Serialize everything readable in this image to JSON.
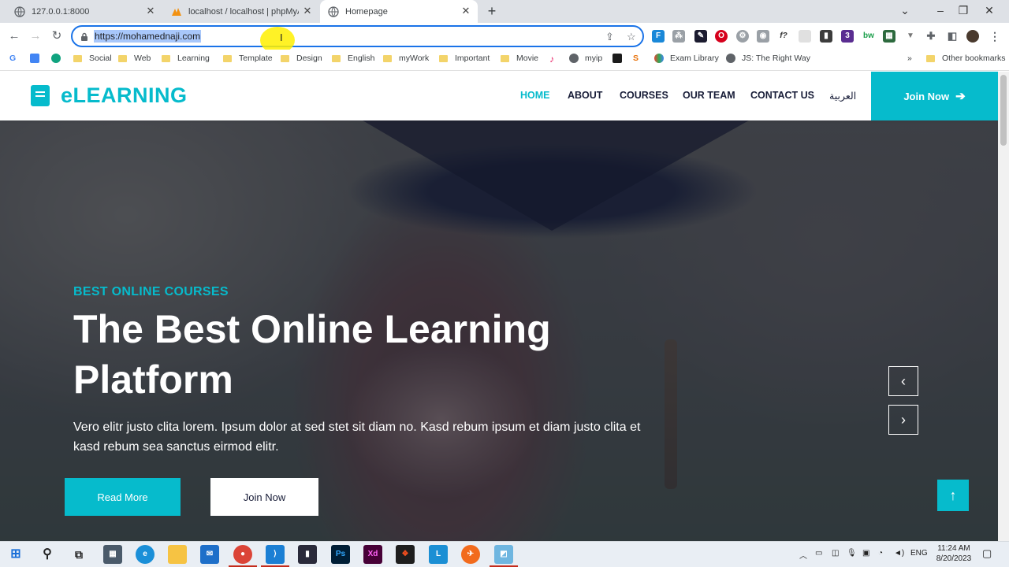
{
  "browser": {
    "tabs": [
      {
        "title": "127.0.0.1:8000",
        "active": false
      },
      {
        "title": "localhost / localhost | phpMyAdmin",
        "active": false
      },
      {
        "title": "Homepage",
        "active": true
      }
    ],
    "new_tab_symbol": "+",
    "window_controls": {
      "minimize": "–",
      "maximize": "❐",
      "close": "✕"
    },
    "chevron": "⌄",
    "url": "https://mohamednaji.com",
    "bookmarks": [
      "Social",
      "Web",
      "Learning",
      "Template",
      "Design",
      "English",
      "myWork",
      "Important",
      "Movie",
      "myip",
      "Exam Library",
      "JS: The Right Way"
    ],
    "more_bookmarks": "»",
    "other_bookmarks": "Other bookmarks"
  },
  "site": {
    "logo": "eLEARNING",
    "menu": [
      "HOME",
      "ABOUT",
      "COURSES",
      "OUR TEAM",
      "CONTACT US",
      "العربية"
    ],
    "nav_join": "Join Now",
    "hero": {
      "subtitle": "BEST ONLINE COURSES",
      "title": "The Best Online Learning Platform",
      "description": "Vero elitr justo clita lorem. Ipsum dolor at sed stet sit diam no. Kasd rebum ipsum et diam justo clita et kasd rebum sea sanctus eirmod elitr.",
      "read_more": "Read More",
      "join_now": "Join Now",
      "prev_symbol": "‹",
      "next_symbol": "›",
      "top_symbol": "↑"
    }
  },
  "taskbar": {
    "language": "ENG",
    "time": "11:24 AM",
    "date": "8/20/2023",
    "extension_badge": "3"
  },
  "colors": {
    "accent": "#06bbcc",
    "dark": "#181d38",
    "omnibox_focus": "#1a73e8"
  }
}
